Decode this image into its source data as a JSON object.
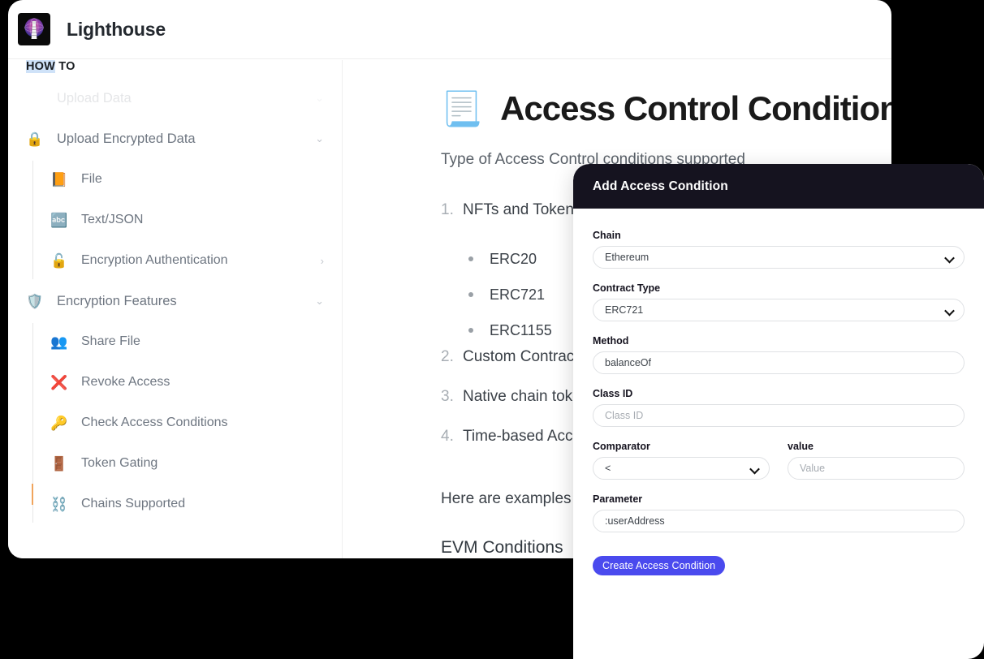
{
  "window": {
    "brand_name": "Lighthouse",
    "logo_icon": "lighthouse-globe-logo"
  },
  "sidebar": {
    "section_label_prefix": "HOW",
    "section_label_suffix": " TO",
    "ghost_item": {
      "label": "Upload Data",
      "chevron": "⌄"
    },
    "items": [
      {
        "icon": "🔒",
        "icon_name": "lock-icon",
        "label": "Upload Encrypted Data",
        "chevron": "⌄",
        "nested": false
      },
      {
        "icon": "📙",
        "icon_name": "file-icon",
        "label": "File",
        "chevron": "",
        "nested": true
      },
      {
        "icon": "🔤",
        "icon_name": "abc-text-icon",
        "label": "Text/JSON",
        "chevron": "",
        "nested": true
      },
      {
        "icon": "🔓",
        "icon_name": "unlock-icon",
        "label": "Encryption Authentication",
        "chevron": "›",
        "nested": true
      },
      {
        "icon": "🛡️",
        "icon_name": "shield-icon",
        "label": "Encryption Features",
        "chevron": "⌄",
        "nested": false
      },
      {
        "icon": "👥",
        "icon_name": "share-file-icon",
        "label": "Share File",
        "chevron": "",
        "nested": true
      },
      {
        "icon": "❌",
        "icon_name": "revoke-access-icon",
        "label": "Revoke Access",
        "chevron": "",
        "nested": true
      },
      {
        "icon": "🔑",
        "icon_name": "key-icon",
        "label": "Check Access Conditions",
        "chevron": "",
        "nested": true
      },
      {
        "icon": "🚪",
        "icon_name": "token-gating-icon",
        "label": "Token Gating",
        "chevron": "",
        "nested": true
      },
      {
        "icon": "⛓️",
        "icon_name": "chains-icon",
        "label": "Chains Supported",
        "chevron": "",
        "nested": true
      }
    ]
  },
  "doc": {
    "title_icon": "📃",
    "title": "Access Control Conditions",
    "subtitle": "Type of Access Control conditions supported",
    "list": [
      {
        "num": "1.",
        "text": "NFTs and Tokens",
        "sub": [
          "ERC20",
          "ERC721",
          "ERC1155"
        ]
      },
      {
        "num": "2.",
        "text": "Custom Contract",
        "sub": []
      },
      {
        "num": "3.",
        "text": "Native chain token",
        "sub": []
      },
      {
        "num": "4.",
        "text": "Time-based Access",
        "sub": []
      }
    ],
    "para_1": "Here are examples",
    "heading_2": "EVM Conditions"
  },
  "modal": {
    "title": "Add Access Condition",
    "fields": {
      "chain": {
        "label": "Chain",
        "value": "Ethereum",
        "type": "select"
      },
      "contract_type": {
        "label": "Contract Type",
        "value": "ERC721",
        "type": "select"
      },
      "method": {
        "label": "Method",
        "value": "balanceOf",
        "type": "text"
      },
      "class_id": {
        "label": "Class ID",
        "placeholder": "Class ID",
        "value": "",
        "type": "text"
      },
      "comparator": {
        "label": "Comparator",
        "value": "<",
        "type": "select"
      },
      "value": {
        "label": "value",
        "placeholder": "Value",
        "value": "",
        "type": "text"
      },
      "parameter": {
        "label": "Parameter",
        "value": ":userAddress",
        "type": "text"
      }
    },
    "submit_label": "Create Access Condition"
  },
  "colors": {
    "page_background": "#000000",
    "modal_header": "#15131f",
    "primary_button": "#4a4aee",
    "active_marker": "#f0a45c",
    "highlight": "#cfe2f8"
  }
}
